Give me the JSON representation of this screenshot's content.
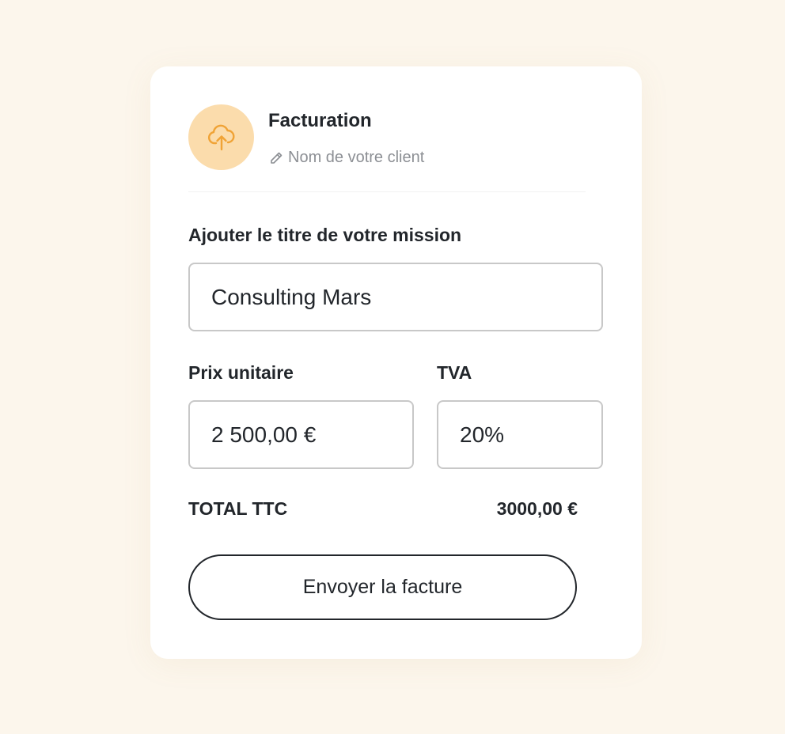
{
  "header": {
    "title": "Facturation",
    "client_placeholder": "Nom de votre client",
    "avatar_icon": "cloud-upload-icon",
    "client_icon": "pencil-icon",
    "avatar_bg": "#fbdcac",
    "avatar_icon_color": "#f0a336"
  },
  "mission": {
    "label": "Ajouter le titre de votre mission",
    "value": "Consulting Mars"
  },
  "price": {
    "label": "Prix unitaire",
    "value": "2 500,00 €"
  },
  "vat": {
    "label": "TVA",
    "value": "20%"
  },
  "total": {
    "label": "TOTAL TTC",
    "value": "3000,00 €"
  },
  "actions": {
    "send_label": "Envoyer la facture"
  },
  "colors": {
    "background": "#fcf6ec",
    "card": "#ffffff",
    "text": "#22262b",
    "muted": "#8c8f94",
    "border": "#c8c8c8"
  }
}
